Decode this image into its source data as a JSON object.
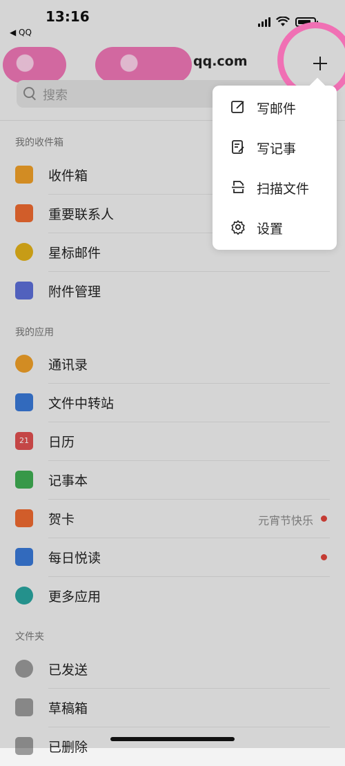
{
  "status_bar": {
    "time": "13:16",
    "back_app": "◀ QQ"
  },
  "header": {
    "account_suffix": "qq.com"
  },
  "search": {
    "placeholder": "搜索"
  },
  "sections": {
    "inbox_title": "我的收件箱",
    "apps_title": "我的应用",
    "folders_title": "文件夹"
  },
  "inbox_items": [
    {
      "label": "收件箱",
      "icon": "inbox-tray-icon",
      "color": "#f0a028"
    },
    {
      "label": "重要联系人",
      "icon": "bookmark-icon",
      "color": "#ee6a30"
    },
    {
      "label": "星标邮件",
      "icon": "star-icon",
      "color": "#e3b21a"
    },
    {
      "label": "附件管理",
      "icon": "attachment-icon",
      "color": "#5d6fd8"
    }
  ],
  "app_items": [
    {
      "label": "通讯录",
      "icon": "contacts-icon",
      "color": "#f0a028"
    },
    {
      "label": "文件中转站",
      "icon": "folder-icon",
      "color": "#3a79d8"
    },
    {
      "label": "日历",
      "icon": "calendar-icon",
      "color": "#e05050",
      "badge_text": "21"
    },
    {
      "label": "记事本",
      "icon": "notebook-icon",
      "color": "#3fae52"
    },
    {
      "label": "贺卡",
      "icon": "greeting-card-icon",
      "color": "#ee6a30",
      "extra": "元宵节快乐",
      "dot": true
    },
    {
      "label": "每日悦读",
      "icon": "daily-reading-icon",
      "color": "#3a79d8",
      "dot": true
    },
    {
      "label": "更多应用",
      "icon": "more-apps-icon",
      "color": "#2aa5a0"
    }
  ],
  "folder_items": [
    {
      "label": "已发送",
      "icon": "sent-icon",
      "color": "#9a9a9a"
    },
    {
      "label": "草稿箱",
      "icon": "drafts-icon",
      "color": "#9a9a9a"
    },
    {
      "label": "已删除",
      "icon": "trash-icon",
      "color": "#9a9a9a"
    }
  ],
  "menu": {
    "items": [
      {
        "label": "写邮件",
        "icon": "compose-icon"
      },
      {
        "label": "写记事",
        "icon": "note-icon"
      },
      {
        "label": "扫描文件",
        "icon": "scan-icon"
      },
      {
        "label": "设置",
        "icon": "settings-gear-icon"
      }
    ]
  },
  "colors": {
    "accent_dot": "#e0443b",
    "annotation_pink": "#f070b4"
  }
}
